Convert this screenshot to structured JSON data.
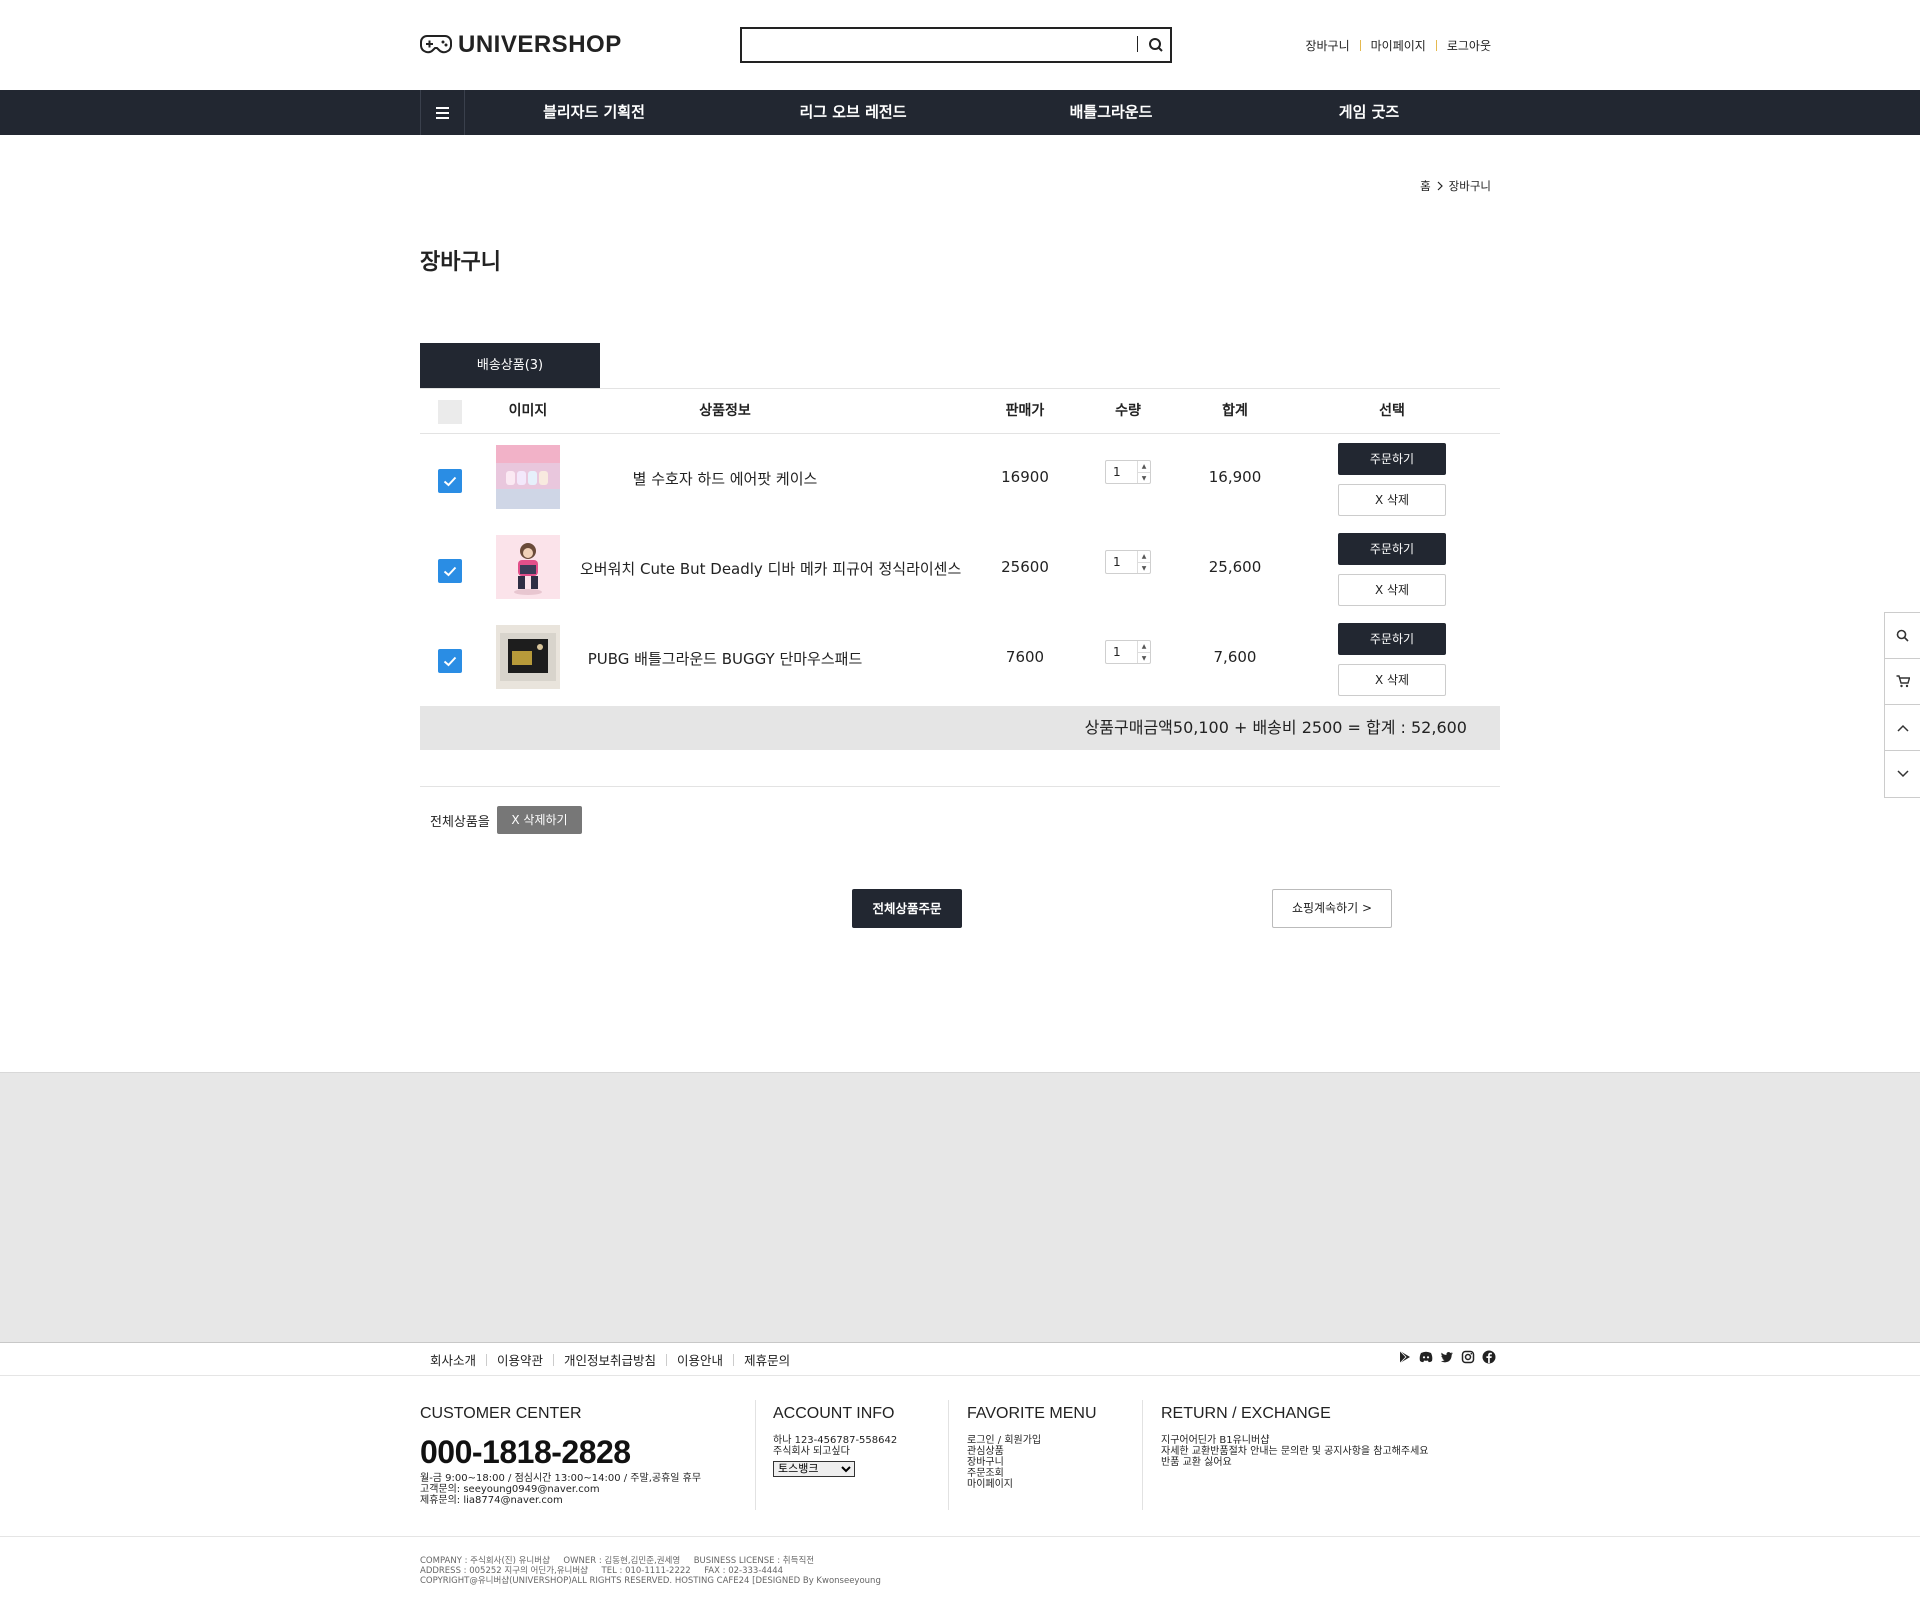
{
  "header": {
    "logo_text": "UNIVERSHOP",
    "search_placeholder": "",
    "links": [
      "장바구니",
      "마이페이지",
      "로그아웃"
    ]
  },
  "nav": {
    "items": [
      "블리자드 기획전",
      "리그 오브 레전드",
      "배틀그라운드",
      "게임 굿즈"
    ]
  },
  "breadcrumb": {
    "home": "홈",
    "current": "장바구니"
  },
  "page_title": "장바구니",
  "tab_label": "배송상품(3)",
  "table": {
    "headers": [
      "이미지",
      "상품정보",
      "판매가",
      "수량",
      "합계",
      "선택"
    ],
    "rows": [
      {
        "checked": true,
        "name": "별 수호자 하드 에어팟 케이스",
        "price": "16900",
        "qty": "1",
        "total": "16,900",
        "order_label": "주문하기",
        "delete_label": "X 삭제"
      },
      {
        "checked": true,
        "name": "오버워치 Cute But Deadly 디바 메카 피규어 정식라이센스",
        "price": "25600",
        "qty": "1",
        "total": "25,600",
        "order_label": "주문하기",
        "delete_label": "X 삭제"
      },
      {
        "checked": true,
        "name": "PUBG 배틀그라운드 BUGGY 단마우스패드",
        "price": "7600",
        "qty": "1",
        "total": "7,600",
        "order_label": "주문하기",
        "delete_label": "X 삭제"
      }
    ]
  },
  "summary": "상품구매금액50,100 + 배송비 2500 = 합계 : 52,600",
  "bulk": {
    "label": "전체상품을",
    "delete_all": "X 삭제하기"
  },
  "actions": {
    "order_all": "전체상품주문",
    "continue": "쇼핑계속하기 >"
  },
  "side_bar": [
    "search-icon",
    "cart-icon",
    "arrow-up-icon",
    "arrow-down-icon"
  ],
  "footer": {
    "links": [
      "회사소개",
      "이용약관",
      "개인정보취급방침",
      "이용안내",
      "제휴문의"
    ],
    "social": [
      "google-play-icon",
      "discord-icon",
      "twitter-icon",
      "instagram-icon",
      "facebook-icon"
    ],
    "customer_center": {
      "title": "CUSTOMER CENTER",
      "phone": "000-1818-2828",
      "hours": "월-금 9:00~18:00 / 점심시간 13:00~14:00 / 주말,공휴일 휴무",
      "contact": "고객문의: seeyoung0949@naver.com",
      "partner": "제휴문의: lia8774@naver.com"
    },
    "account_info": {
      "title": "ACCOUNT INFO",
      "line1": "하나 123-456787-558642",
      "line2": "주식회사 되고싶다",
      "bank_selected": "토스뱅크"
    },
    "favorite_menu": {
      "title": "FAVORITE MENU",
      "items": [
        "로그인 / 회원가입",
        "관심상품",
        "장바구니",
        "주문조회",
        "마이페이지"
      ]
    },
    "return_exchange": {
      "title": "RETURN / EXCHANGE",
      "line1": "지구어어딘가 B1유니버샵",
      "line2": "자세한 교환반품절차 안내는 문의란 및 공지사항을 참고해주세요",
      "line3": "반품 교환 싫어요"
    },
    "copyright": {
      "line1": "COMPANY : 주식회사(진) 유니버샵     OWNER : 김동현,김민준,권세영     BUSINESS LICENSE : 취득직전",
      "line2": "ADDRESS : 005252 지구의 어딘가,유니버샵     TEL : 010-1111-2222     FAX : 02-333-4444",
      "line3": "COPYRIGHT@유니버샵(UNIVERSHOP)ALL RIGHTS RESERVED. HOSTING CAFE24 [DESIGNED By Kwonseeyoung"
    }
  },
  "colors": {
    "nav_bg": "#222731",
    "checkbox": "#2a8de4",
    "accent_sep": "#e5b94f",
    "footer_band": "#e7e7e7"
  }
}
